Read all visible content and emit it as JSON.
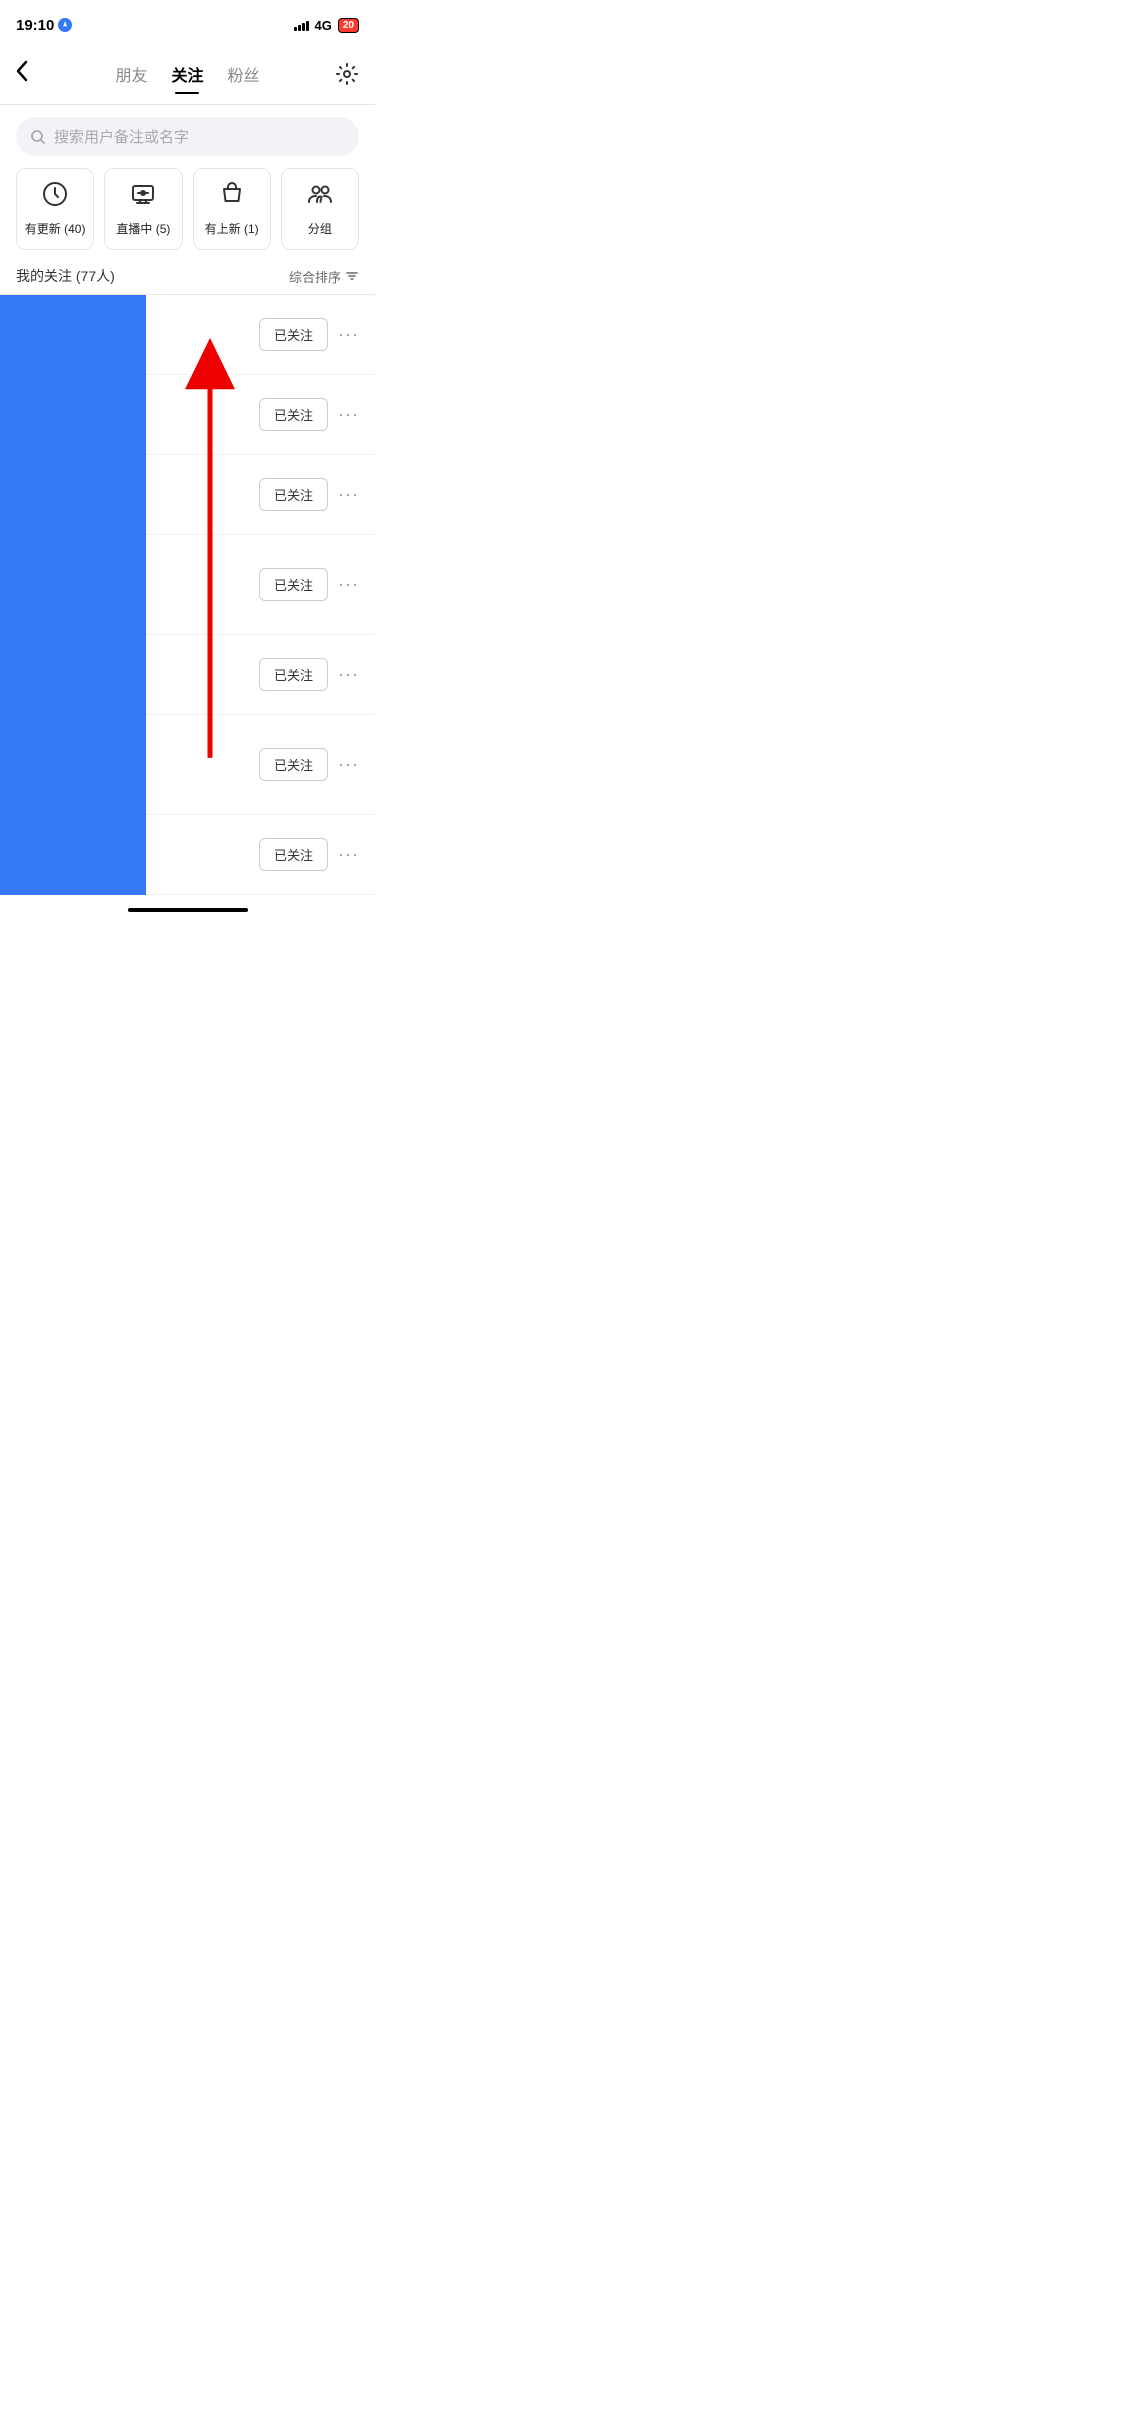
{
  "statusBar": {
    "time": "19:10",
    "signal": "4G",
    "battery": "20"
  },
  "nav": {
    "backLabel": "‹",
    "tabs": [
      {
        "id": "friends",
        "label": "朋友",
        "active": false
      },
      {
        "id": "following",
        "label": "关注",
        "active": true
      },
      {
        "id": "fans",
        "label": "粉丝",
        "active": false
      }
    ],
    "settingsLabel": "⚙"
  },
  "search": {
    "placeholder": "搜索用户备注或名字"
  },
  "categories": [
    {
      "id": "updates",
      "icon": "🕐",
      "label": "有更新 (40)"
    },
    {
      "id": "live",
      "icon": "📺",
      "label": "直播中 (5)"
    },
    {
      "id": "new",
      "icon": "🛍",
      "label": "有上新 (1)"
    },
    {
      "id": "groups",
      "icon": "👥",
      "label": "分组"
    }
  ],
  "followingHeader": {
    "countLabel": "我的关注 (77人)",
    "sortLabel": "综合排序"
  },
  "users": [
    {
      "id": 1,
      "name": "",
      "desc": "",
      "followLabel": "已关注",
      "hasChevron": false
    },
    {
      "id": 2,
      "name": "",
      "desc": "",
      "followLabel": "已关注",
      "hasChevron": false
    },
    {
      "id": 3,
      "name": "",
      "desc": "",
      "followLabel": "已关注",
      "hasChevron": false
    },
    {
      "id": 4,
      "name": "",
      "desc": "",
      "followLabel": "已关注",
      "hasChevron": true
    },
    {
      "id": 5,
      "name": "",
      "desc": "",
      "followLabel": "已关注",
      "hasChevron": false
    },
    {
      "id": 6,
      "name": "",
      "desc": "",
      "followLabel": "已关注",
      "hasChevron": true
    },
    {
      "id": 7,
      "name": "",
      "desc": "",
      "followLabel": "已关注",
      "hasChevron": false
    }
  ],
  "moreDotsLabel": "···"
}
